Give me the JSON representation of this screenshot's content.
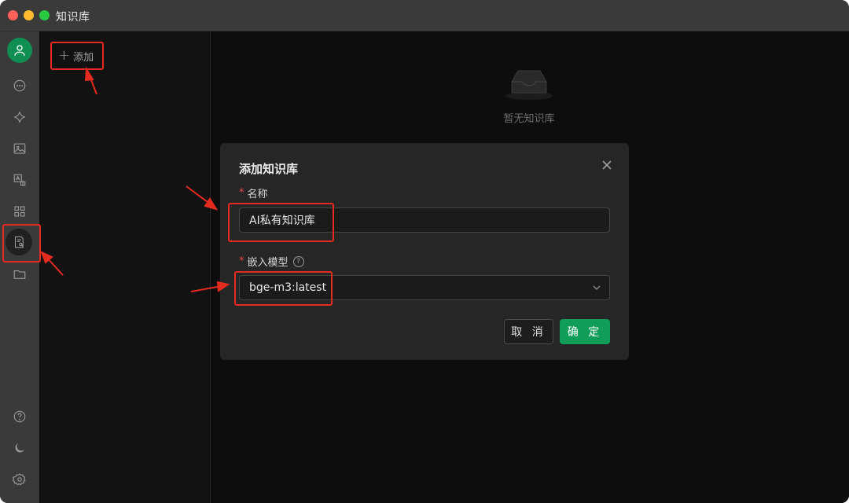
{
  "window": {
    "title": "知识库"
  },
  "sidebar": {
    "items": [
      {
        "icon": "user-avatar-icon"
      },
      {
        "icon": "chat-icon"
      },
      {
        "icon": "sparkle-icon"
      },
      {
        "icon": "image-icon"
      },
      {
        "icon": "translate-icon"
      },
      {
        "icon": "apps-grid-icon"
      },
      {
        "icon": "knowledge-base-icon",
        "active": true
      },
      {
        "icon": "folder-icon"
      }
    ],
    "bottom": [
      {
        "icon": "help-icon"
      },
      {
        "icon": "moon-icon"
      },
      {
        "icon": "settings-icon"
      }
    ]
  },
  "panel": {
    "add_label": "添加"
  },
  "main": {
    "empty_text": "暂无知识库"
  },
  "dialog": {
    "title": "添加知识库",
    "name_label": "名称",
    "name_value": "AI私有知识库",
    "model_label": "嵌入模型",
    "model_value": "bge-m3:latest",
    "cancel_label": "取 消",
    "ok_label": "确 定",
    "required_mark": "*",
    "help_mark": "?"
  },
  "colors": {
    "accent": "#0f9d58",
    "annotation": "#e52b1f",
    "required": "#e5484d"
  }
}
